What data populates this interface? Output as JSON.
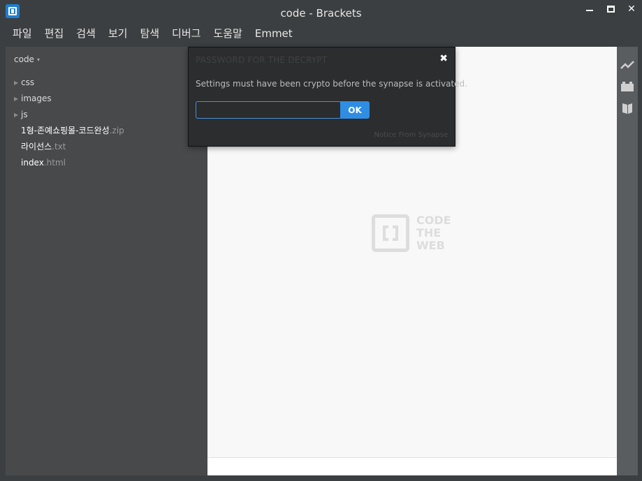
{
  "window": {
    "title": "code - Brackets"
  },
  "menu": {
    "items": [
      {
        "label": "파일"
      },
      {
        "label": "편집"
      },
      {
        "label": "검색"
      },
      {
        "label": "보기"
      },
      {
        "label": "탐색"
      },
      {
        "label": "디버그"
      },
      {
        "label": "도움말"
      },
      {
        "label": "Emmet"
      }
    ]
  },
  "sidebar": {
    "project_name": "code",
    "project_caret": "▾",
    "folders": [
      {
        "name": "css"
      },
      {
        "name": "images"
      },
      {
        "name": "js"
      }
    ],
    "files": [
      {
        "name": "1형-존예쇼핑몰-코드완성",
        "ext": ".zip"
      },
      {
        "name": "라이선스",
        "ext": ".txt"
      },
      {
        "name": "index",
        "ext": ".html"
      }
    ]
  },
  "editor": {
    "logo_line1": "CODE",
    "logo_line2": "THE",
    "logo_line3": "WEB"
  },
  "modal": {
    "title": "PASSWORD FOR THE DECRYPT",
    "close": "✖",
    "message": "Settings must have been crypto before the synapse is activated.",
    "input_value": "",
    "ok_label": "OK",
    "footer": "Notice From Synapse"
  },
  "icons": {
    "app": "brackets-logo-icon",
    "live_preview": "live-preview-icon",
    "extension_manager": "extension-manager-icon",
    "extract": "extract-icon"
  },
  "colors": {
    "accent": "#2f8de4",
    "sidebar_bg": "#47494b",
    "editor_bg": "#f8f8f8",
    "modal_bg": "#2b2d2f"
  }
}
